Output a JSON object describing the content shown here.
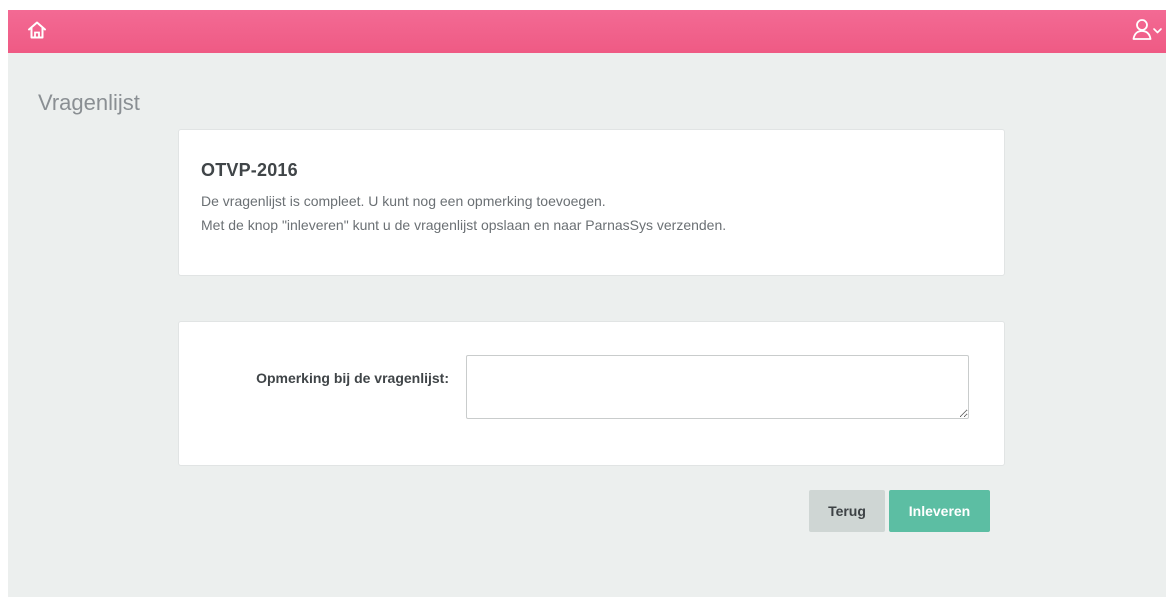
{
  "header": {
    "home_icon": "home-icon",
    "user_icon": "user-icon",
    "dropdown_icon": "chevron-down-icon",
    "bar_color": "#f0608a"
  },
  "page": {
    "title": "Vragenlijst"
  },
  "info_card": {
    "title": "OTVP-2016",
    "line1": "De vragenlijst is compleet. U kunt nog een opmerking toevoegen.",
    "line2": "Met de knop \"inleveren\" kunt u de vragenlijst opslaan en naar ParnasSys verzenden."
  },
  "remark_card": {
    "label": "Opmerking bij de vragenlijst:",
    "value": ""
  },
  "actions": {
    "back_label": "Terug",
    "submit_label": "Inleveren",
    "submit_color": "#5cbea3"
  }
}
